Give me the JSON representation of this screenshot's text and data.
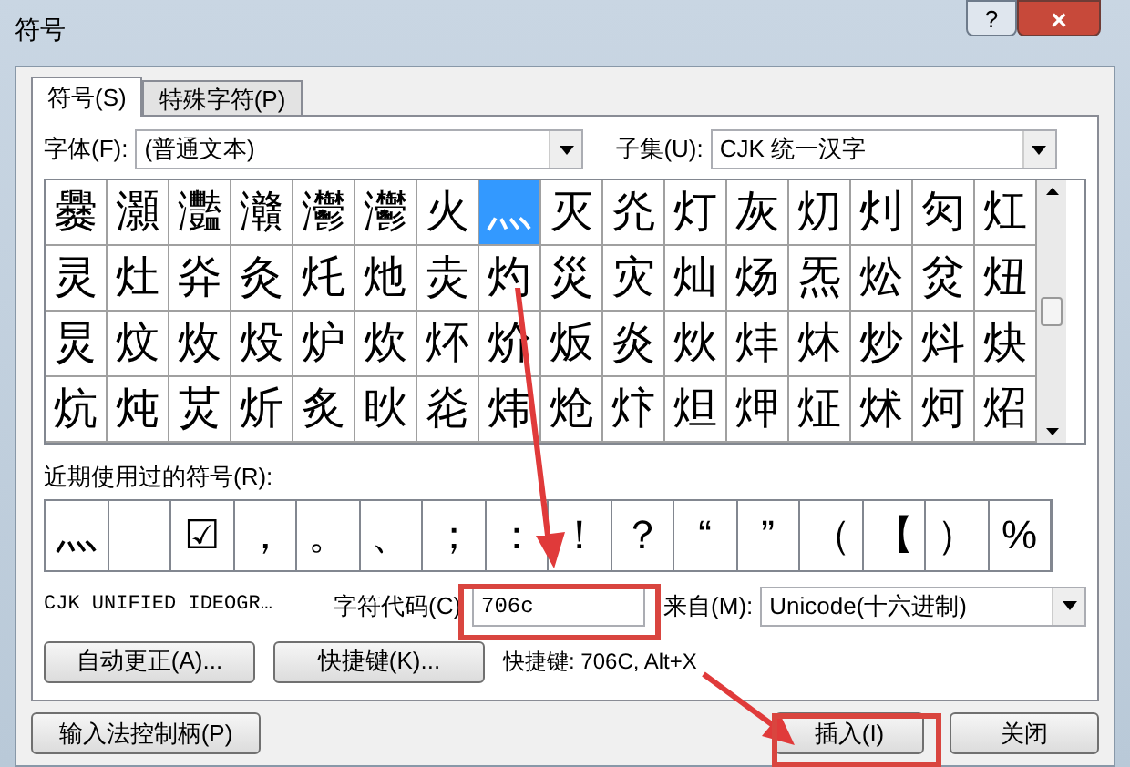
{
  "window": {
    "title": "符号",
    "help": "?",
    "close": "×"
  },
  "tabs": [
    {
      "label": "符号(S)",
      "selected": true
    },
    {
      "label": "特殊字符(P)",
      "selected": false
    }
  ],
  "font": {
    "label": "字体(F):",
    "value": "(普通文本)"
  },
  "subset": {
    "label": "子集(U):",
    "value": "CJK 统一汉字"
  },
  "grid": [
    [
      {
        "char": "爨",
        "selected": false
      },
      {
        "char": "灝",
        "selected": false
      },
      {
        "char": "灩",
        "selected": false
      },
      {
        "char": "灨",
        "selected": false
      },
      {
        "char": "灪",
        "selected": false
      },
      {
        "char": "灪",
        "selected": false
      },
      {
        "char": "火",
        "selected": false
      },
      {
        "char": "灬",
        "selected": true
      },
      {
        "char": "灭",
        "selected": false
      },
      {
        "char": "灮",
        "selected": false
      },
      {
        "char": "灯",
        "selected": false
      },
      {
        "char": "灰",
        "selected": false
      },
      {
        "char": "灱",
        "selected": false
      },
      {
        "char": "灲",
        "selected": false
      },
      {
        "char": "灳",
        "selected": false
      },
      {
        "char": "灴",
        "selected": false
      }
    ],
    [
      {
        "char": "灵",
        "selected": false
      },
      {
        "char": "灶",
        "selected": false
      },
      {
        "char": "灷",
        "selected": false
      },
      {
        "char": "灸",
        "selected": false
      },
      {
        "char": "灹",
        "selected": false
      },
      {
        "char": "灺",
        "selected": false
      },
      {
        "char": "灻",
        "selected": false
      },
      {
        "char": "灼",
        "selected": false
      },
      {
        "char": "災",
        "selected": false
      },
      {
        "char": "灾",
        "selected": false
      },
      {
        "char": "灿",
        "selected": false
      },
      {
        "char": "炀",
        "selected": false
      },
      {
        "char": "炁",
        "selected": false
      },
      {
        "char": "炂",
        "selected": false
      },
      {
        "char": "炃",
        "selected": false
      },
      {
        "char": "炄",
        "selected": false
      }
    ],
    [
      {
        "char": "炅",
        "selected": false
      },
      {
        "char": "炆",
        "selected": false
      },
      {
        "char": "炇",
        "selected": false
      },
      {
        "char": "炈",
        "selected": false
      },
      {
        "char": "炉",
        "selected": false
      },
      {
        "char": "炊",
        "selected": false
      },
      {
        "char": "炋",
        "selected": false
      },
      {
        "char": "炌",
        "selected": false
      },
      {
        "char": "炍",
        "selected": false
      },
      {
        "char": "炎",
        "selected": false
      },
      {
        "char": "炏",
        "selected": false
      },
      {
        "char": "炐",
        "selected": false
      },
      {
        "char": "炑",
        "selected": false
      },
      {
        "char": "炒",
        "selected": false
      },
      {
        "char": "炓",
        "selected": false
      },
      {
        "char": "炔",
        "selected": false
      }
    ],
    [
      {
        "char": "炕",
        "selected": false
      },
      {
        "char": "炖",
        "selected": false
      },
      {
        "char": "炗",
        "selected": false
      },
      {
        "char": "炘",
        "selected": false
      },
      {
        "char": "炙",
        "selected": false
      },
      {
        "char": "炚",
        "selected": false
      },
      {
        "char": "炛",
        "selected": false
      },
      {
        "char": "炜",
        "selected": false
      },
      {
        "char": "炝",
        "selected": false
      },
      {
        "char": "炞",
        "selected": false
      },
      {
        "char": "炟",
        "selected": false
      },
      {
        "char": "炠",
        "selected": false
      },
      {
        "char": "炡",
        "selected": false
      },
      {
        "char": "炢",
        "selected": false
      },
      {
        "char": "炣",
        "selected": false
      },
      {
        "char": "炤",
        "selected": false
      }
    ]
  ],
  "recent": {
    "label": "近期使用过的符号(R):",
    "symbols": [
      {
        "kind": "char",
        "symbol": "灬"
      },
      {
        "kind": "empty"
      },
      {
        "kind": "char",
        "symbol": "☑"
      },
      {
        "kind": "char",
        "symbol": "，"
      },
      {
        "kind": "char",
        "symbol": "。"
      },
      {
        "kind": "char",
        "symbol": "、"
      },
      {
        "kind": "char",
        "symbol": "；"
      },
      {
        "kind": "char",
        "symbol": "："
      },
      {
        "kind": "char",
        "symbol": "！"
      },
      {
        "kind": "char",
        "symbol": "？"
      },
      {
        "kind": "char",
        "symbol": "“"
      },
      {
        "kind": "char",
        "symbol": "”"
      },
      {
        "kind": "char",
        "symbol": "（"
      },
      {
        "kind": "char",
        "symbol": "【"
      },
      {
        "kind": "char",
        "symbol": "）"
      },
      {
        "kind": "char",
        "symbol": "%"
      }
    ]
  },
  "char_name": "CJK UNIFIED IDEOGR…",
  "code": {
    "label": "字符代码(C)",
    "value": "706c"
  },
  "from": {
    "label": "来自(M):",
    "value": "Unicode(十六进制)"
  },
  "buttons": [
    "自动更正(A)...",
    "快捷键(K)..."
  ],
  "shortcut": "快捷键: 706C, Alt+X",
  "footer": {
    "ime": "输入法控制柄(P)",
    "insert": "插入(I)",
    "close": "关闭"
  }
}
